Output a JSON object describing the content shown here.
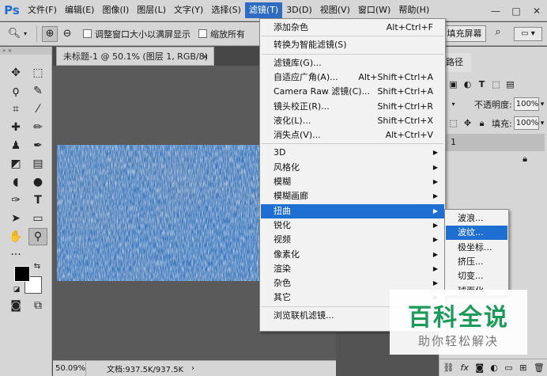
{
  "app": {
    "logo": "Ps"
  },
  "menubar": {
    "items": [
      "文件(F)",
      "编辑(E)",
      "图像(I)",
      "图层(L)",
      "文字(Y)",
      "选择(S)",
      "滤镜(T)",
      "3D(D)",
      "视图(V)",
      "窗口(W)",
      "帮助(H)"
    ],
    "active_index": 6,
    "win_minimize": "—",
    "win_maximize": "□",
    "win_close": "✕"
  },
  "options": {
    "resize_windows_label": "调整窗口大小以满屏显示",
    "zoom_all_windows_label": "缩放所有",
    "fill_screen_label": "填充屏幕"
  },
  "document": {
    "tab_title": "未标题-1 @ 50.1% (图层 1, RGB/8) *",
    "tab_close": "×",
    "zoom_readout": "50.09%",
    "doc_size": "文档:937.5K/937.5K",
    "status_arrow": "›"
  },
  "panel": {
    "tab_label": "路径",
    "opacity_label": "不透明度:",
    "opacity_value": "100%",
    "fill_label": "填充:",
    "fill_value": "100%",
    "layer_name": "1"
  },
  "filter_menu": {
    "groups": [
      [
        {
          "label": "添加杂色",
          "shortcut": "Alt+Ctrl+F"
        }
      ],
      [
        {
          "label": "转换为智能滤镜(S)",
          "shortcut": ""
        }
      ],
      [
        {
          "label": "滤镜库(G)...",
          "shortcut": ""
        },
        {
          "label": "自适应广角(A)...",
          "shortcut": "Alt+Shift+Ctrl+A"
        },
        {
          "label": "Camera Raw 滤镜(C)...",
          "shortcut": "Shift+Ctrl+A"
        },
        {
          "label": "镜头校正(R)...",
          "shortcut": "Shift+Ctrl+R"
        },
        {
          "label": "液化(L)...",
          "shortcut": "Shift+Ctrl+X"
        },
        {
          "label": "消失点(V)...",
          "shortcut": "Alt+Ctrl+V"
        }
      ],
      [
        {
          "label": "3D",
          "submenu": true
        },
        {
          "label": "风格化",
          "submenu": true
        },
        {
          "label": "模糊",
          "submenu": true
        },
        {
          "label": "模糊画廊",
          "submenu": true
        },
        {
          "label": "扭曲",
          "submenu": true,
          "highlighted": true
        },
        {
          "label": "锐化",
          "submenu": true
        },
        {
          "label": "视频",
          "submenu": true
        },
        {
          "label": "像素化",
          "submenu": true
        },
        {
          "label": "渲染",
          "submenu": true
        },
        {
          "label": "杂色",
          "submenu": true
        },
        {
          "label": "其它",
          "submenu": true
        }
      ],
      [
        {
          "label": "浏览联机滤镜...",
          "shortcut": ""
        }
      ]
    ]
  },
  "distort_submenu": {
    "items": [
      "波浪...",
      "波纹...",
      "极坐标...",
      "挤压...",
      "切变...",
      "球面化..."
    ],
    "highlighted_index": 1
  },
  "watermark": {
    "title": "百科全说",
    "subtitle": "助你轻松解决"
  },
  "colors": {
    "menu_highlight": "#1e6fd1",
    "watermark_green": "#1c9a5a",
    "canvas_blue": "#2f65a8"
  }
}
